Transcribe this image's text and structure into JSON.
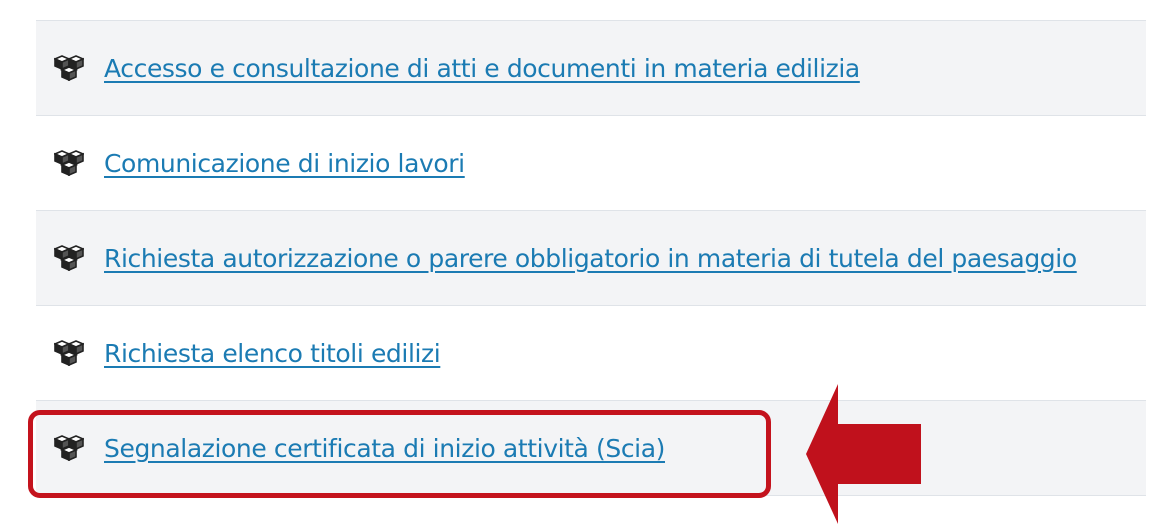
{
  "list": {
    "items": [
      {
        "label": "Accesso e consultazione di atti e documenti in materia edilizia",
        "highlighted": false
      },
      {
        "label": "Comunicazione di inizio lavori",
        "highlighted": false
      },
      {
        "label": "Richiesta autorizzazione o parere obbligatorio in materia di tutela del paesaggio",
        "highlighted": false
      },
      {
        "label": "Richiesta elenco titoli edilizi",
        "highlighted": false
      },
      {
        "label": "Segnalazione certificata di inizio attività (Scia)",
        "highlighted": true
      }
    ],
    "item_icon": "cubes-icon"
  },
  "colors": {
    "link": "#1b7bb3",
    "row_alt_background": "#f3f4f6",
    "highlight": "#c4131d",
    "divider": "#dfe3e8"
  },
  "annotation": {
    "highlight_box_icon": "rounded-rectangle-highlight",
    "arrow_icon": "arrow-left-icon"
  }
}
